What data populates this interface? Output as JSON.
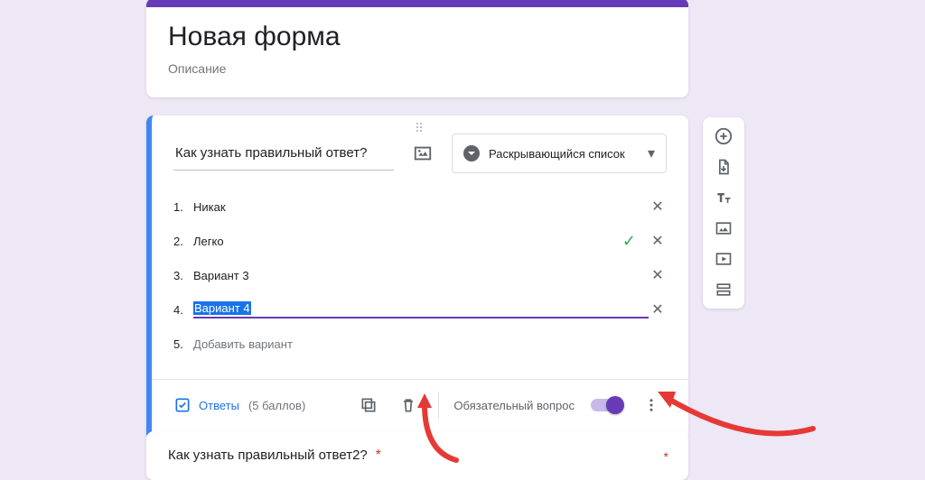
{
  "header": {
    "title": "Новая форма",
    "description": "Описание"
  },
  "question": {
    "title": "Как узнать правильный ответ?",
    "type_label": "Раскрывающийся список",
    "options": [
      {
        "n": "1.",
        "text": "Никак",
        "correct": false
      },
      {
        "n": "2.",
        "text": "Легко",
        "correct": true
      },
      {
        "n": "3.",
        "text": "Вариант 3",
        "correct": false
      },
      {
        "n": "4.",
        "text": "Вариант 4",
        "correct": false,
        "editing": true
      }
    ],
    "add_option": {
      "n": "5.",
      "text": "Добавить вариант"
    }
  },
  "footer": {
    "answers_label": "Ответы",
    "points": "(5 баллов)",
    "required_label": "Обязательный вопрос"
  },
  "next_question": {
    "title": "Как узнать правильный ответ2?",
    "required_marker": "*"
  }
}
